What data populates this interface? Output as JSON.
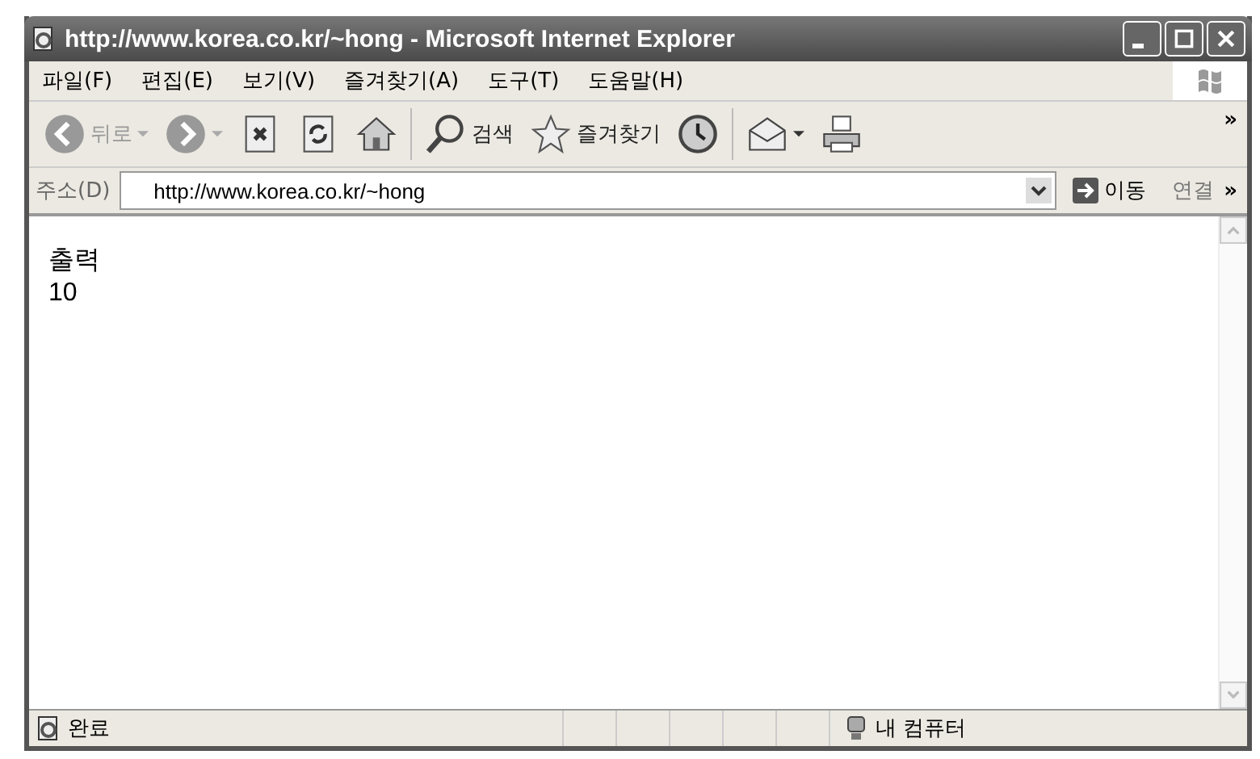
{
  "window": {
    "title": "http://www.korea.co.kr/~hong - Microsoft Internet Explorer"
  },
  "menu": [
    "파일(F)",
    "편집(E)",
    "보기(V)",
    "즐겨찾기(A)",
    "도구(T)",
    "도움말(H)"
  ],
  "toolbar": [
    {
      "kind": "back",
      "label": "뒤로",
      "disabled": true
    },
    {
      "kind": "forward",
      "disabled": true
    },
    {
      "kind": "stop"
    },
    {
      "kind": "refresh"
    },
    {
      "kind": "home"
    },
    {
      "kind": "sep"
    },
    {
      "kind": "search",
      "label": "검색"
    },
    {
      "kind": "favorites",
      "label": "즐겨찾기"
    },
    {
      "kind": "history"
    },
    {
      "kind": "sep"
    },
    {
      "kind": "mail"
    },
    {
      "kind": "print"
    }
  ],
  "toolbar_more": "»",
  "address": {
    "label": "주소(D)",
    "value": "http://www.korea.co.kr/~hong",
    "go": "이동",
    "links": "연결",
    "more": "»"
  },
  "content": [
    "출력",
    "10"
  ],
  "status": {
    "text": "완료",
    "zone": "내 컴퓨터"
  }
}
